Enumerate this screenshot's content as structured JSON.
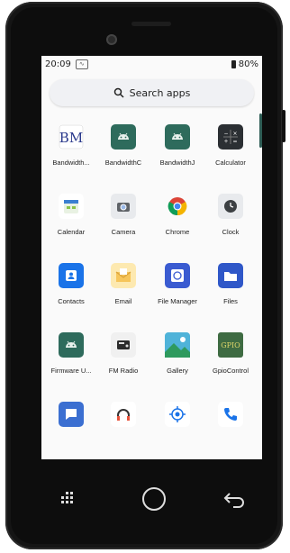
{
  "status": {
    "time": "20:09",
    "battery": "80%"
  },
  "search": {
    "label": "Search apps",
    "icon": "search-icon"
  },
  "apps": [
    {
      "label": "Bandwidth...",
      "icon": "bm-logo-icon",
      "color": "#2b3a8c"
    },
    {
      "label": "BandwidthC",
      "icon": "android-icon",
      "color": "#2e6b5c"
    },
    {
      "label": "BandwidthJ",
      "icon": "android-icon",
      "color": "#2e6b5c"
    },
    {
      "label": "Calculator",
      "icon": "calculator-icon",
      "color": "#2b2f33"
    },
    {
      "label": "Calendar",
      "icon": "calendar-icon",
      "color": "#3b7fd1"
    },
    {
      "label": "Camera",
      "icon": "camera-icon",
      "color": "#e8eaed"
    },
    {
      "label": "Chrome",
      "icon": "chrome-icon",
      "color": "#ffffff"
    },
    {
      "label": "Clock",
      "icon": "clock-icon",
      "color": "#e8eaed"
    },
    {
      "label": "Contacts",
      "icon": "contacts-icon",
      "color": "#1a73e8"
    },
    {
      "label": "Email",
      "icon": "email-icon",
      "color": "#f6c55a"
    },
    {
      "label": "File Manager",
      "icon": "file-manager-icon",
      "color": "#3a5bd1"
    },
    {
      "label": "Files",
      "icon": "folder-icon",
      "color": "#2f57c8"
    },
    {
      "label": "Firmware U...",
      "icon": "android-icon",
      "color": "#2e6b5c"
    },
    {
      "label": "FM Radio",
      "icon": "radio-icon",
      "color": "#f0f0f0"
    },
    {
      "label": "Gallery",
      "icon": "gallery-icon",
      "color": "#3fa9c9"
    },
    {
      "label": "GpioControl",
      "icon": "gpio-icon",
      "color": "#3e6b42"
    },
    {
      "label": "",
      "icon": "message-icon",
      "color": "#3b6fd1"
    },
    {
      "label": "",
      "icon": "headset-icon",
      "color": "#ffffff"
    },
    {
      "label": "",
      "icon": "location-icon",
      "color": "#ffffff"
    },
    {
      "label": "",
      "icon": "phone-icon",
      "color": "#ffffff"
    }
  ],
  "nav": {
    "menu": "grid-menu-icon",
    "home": "home-circle-icon",
    "back": "back-arrow-icon"
  },
  "colors": {
    "accent": "#2e5d55",
    "device": "#151515",
    "screen": "#fafafa"
  },
  "bm_text": "BM",
  "gpio_text": "GPIO"
}
